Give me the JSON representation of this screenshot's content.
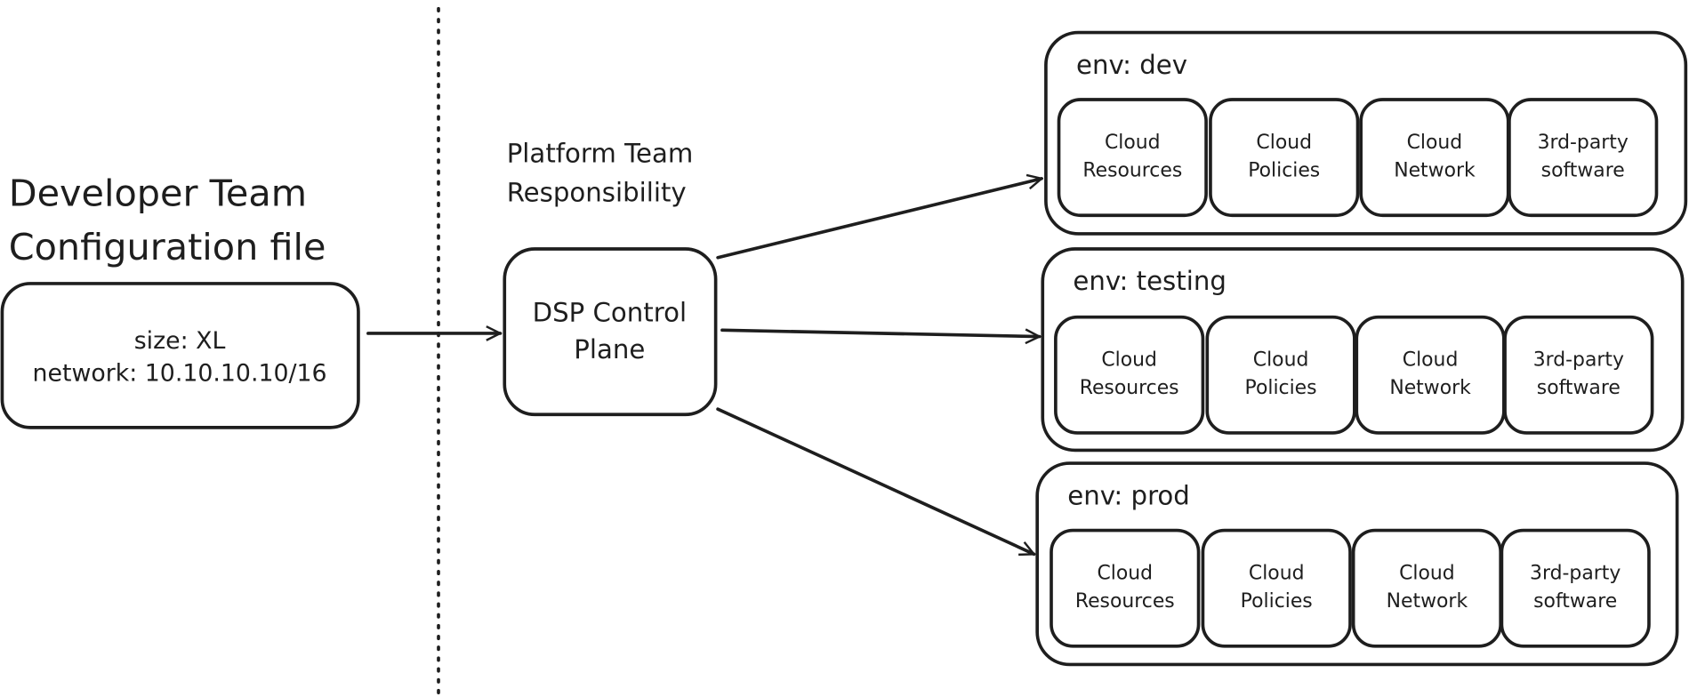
{
  "developer": {
    "title_line1": "Developer Team",
    "title_line2": "Configuration file",
    "config_line1": "size: XL",
    "config_line2": "network: 10.10.10.10/16"
  },
  "platform": {
    "title_line1": "Platform Team",
    "title_line2": "Responsibility",
    "control_plane_line1": "DSP Control",
    "control_plane_line2": "Plane"
  },
  "environments": [
    {
      "label": "env: dev",
      "components": [
        [
          "Cloud",
          "Resources"
        ],
        [
          "Cloud",
          "Policies"
        ],
        [
          "Cloud",
          "Network"
        ],
        [
          "3rd-party",
          "software"
        ]
      ]
    },
    {
      "label": "env: testing",
      "components": [
        [
          "Cloud",
          "Resources"
        ],
        [
          "Cloud",
          "Policies"
        ],
        [
          "Cloud",
          "Network"
        ],
        [
          "3rd-party",
          "software"
        ]
      ]
    },
    {
      "label": "env: prod",
      "components": [
        [
          "Cloud",
          "Resources"
        ],
        [
          "Cloud",
          "Policies"
        ],
        [
          "Cloud",
          "Network"
        ],
        [
          "3rd-party",
          "software"
        ]
      ]
    }
  ],
  "colors": {
    "stroke": "#1e1e1e",
    "background": "#ffffff"
  }
}
